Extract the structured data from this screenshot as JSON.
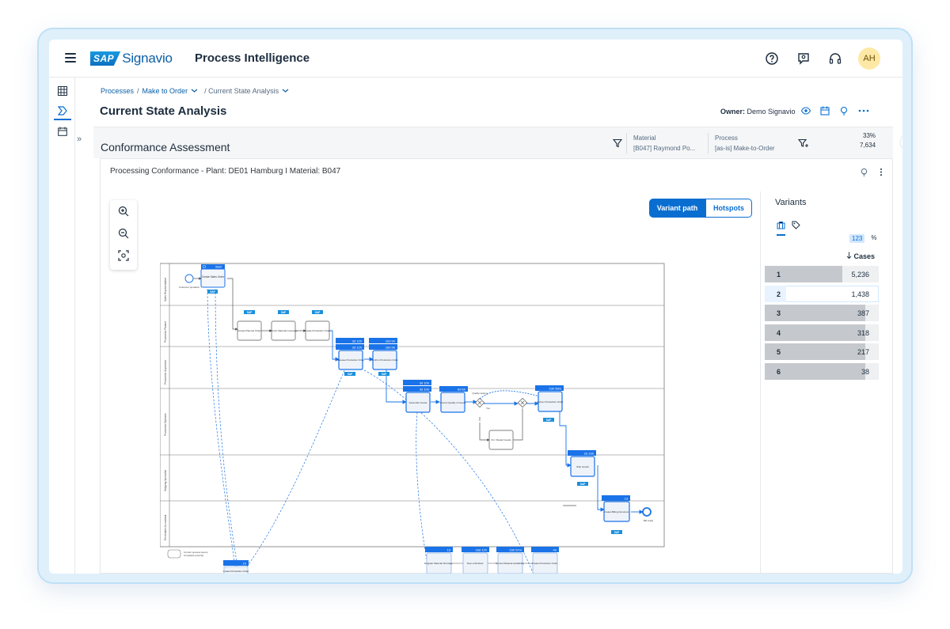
{
  "shell": {
    "brand_badge": "SAP",
    "brand_name": "Signavio",
    "app_title": "Process Intelligence",
    "avatar": "AH",
    "icons": [
      "menu-icon",
      "help-icon",
      "feedback-icon",
      "headset-icon"
    ]
  },
  "breadcrumb": {
    "item1": "Processes",
    "sep1": "/",
    "item2": "Make to Order",
    "item3": "/ Current State Analysis"
  },
  "page": {
    "title": "Current State Analysis",
    "owner_label": "Owner:",
    "owner_name": "Demo Signavio"
  },
  "assessment": {
    "title": "Conformance Assessment",
    "filter1_label": "Material",
    "filter1_value": "[B047] Raymond Po...",
    "filter2_label": "Process",
    "filter2_value": "[as-is] Make-to-Order",
    "percent": "33%",
    "count": "7,634",
    "pie_fraction": 0.33
  },
  "panel": {
    "title": "Processing Conformance - Plant: DE01 Hamburg I Material: B047",
    "variant_path": "Variant path",
    "hotspots": "Hotspots"
  },
  "variants": {
    "title": "Variants",
    "unit_number": "123",
    "unit_percent": "%",
    "sort_label": "Cases",
    "rows": [
      {
        "rank": "1",
        "cases": "5,236"
      },
      {
        "rank": "2",
        "cases": "1,438"
      },
      {
        "rank": "3",
        "cases": "387"
      },
      {
        "rank": "4",
        "cases": "318"
      },
      {
        "rank": "5",
        "cases": "217"
      },
      {
        "rank": "6",
        "cases": "38"
      }
    ]
  },
  "diagram": {
    "lanes": [
      "Sales Representative",
      "Production Planner",
      "Production Supervisor",
      "Production Operator",
      "Shipping Specialist",
      "Receivable Accountant"
    ],
    "tasks": {
      "create_sales_order": "Create Sales Order",
      "create_planned_order": "Create Planned Order",
      "monitor_material": "Monitor Material Coverage",
      "create_production_order": "Create Production Order",
      "release_production_order": "Release Production Order",
      "confirm_production_order": "Confirm Production Order",
      "assemble_goods": "Assemble Goods",
      "control_quality": "Control Quality of Goods",
      "fix_repair": "Fix / Repair Goods",
      "deliver_production_order": "Deliver Production Order",
      "ship_goods": "Ship Goods",
      "create_billing": "Create Billing Document",
      "create_production_order_2": "Create Production Order",
      "register_material": "Register Material Shortage",
      "stop_unfinished": "Stop unfinished",
      "correct_material": "Correct Material Availability",
      "create_production_order_3": "Create Production Order"
    },
    "durations": {
      "start": "Start",
      "release": "3d 12h",
      "confirm": "16d 9h",
      "assemble_a": "3d 10h",
      "assemble_b": "3d 10h",
      "quality": "6d 6h",
      "deliver": "23h 59m",
      "ship": "2d 23h",
      "billing": "1d",
      "release_b": "3d 12h",
      "confirm_b": "16d 9h",
      "extra1": "1h",
      "extra2": "1d",
      "extra3": "16d 12h",
      "extra4": "23h 57m",
      "extra5": "4h"
    },
    "gateway_label": "Quality testing",
    "gateway_yes": "Yes",
    "start_event": "Customer quotation",
    "end_event": "Bill ready",
    "legend1": "Current process (as-is)",
    "legend2": "Compliant (events)",
    "sap_small": "SAP",
    "system_labels": [
      "SAP S/4",
      "SAP S/4",
      "SAP S/4",
      "SAP FICO"
    ]
  },
  "colors": {
    "accent": "#0a6ed1",
    "duration_header": "#1a73e8",
    "frame": "#dff0fb",
    "variant_bar": "#c5c9cd"
  }
}
